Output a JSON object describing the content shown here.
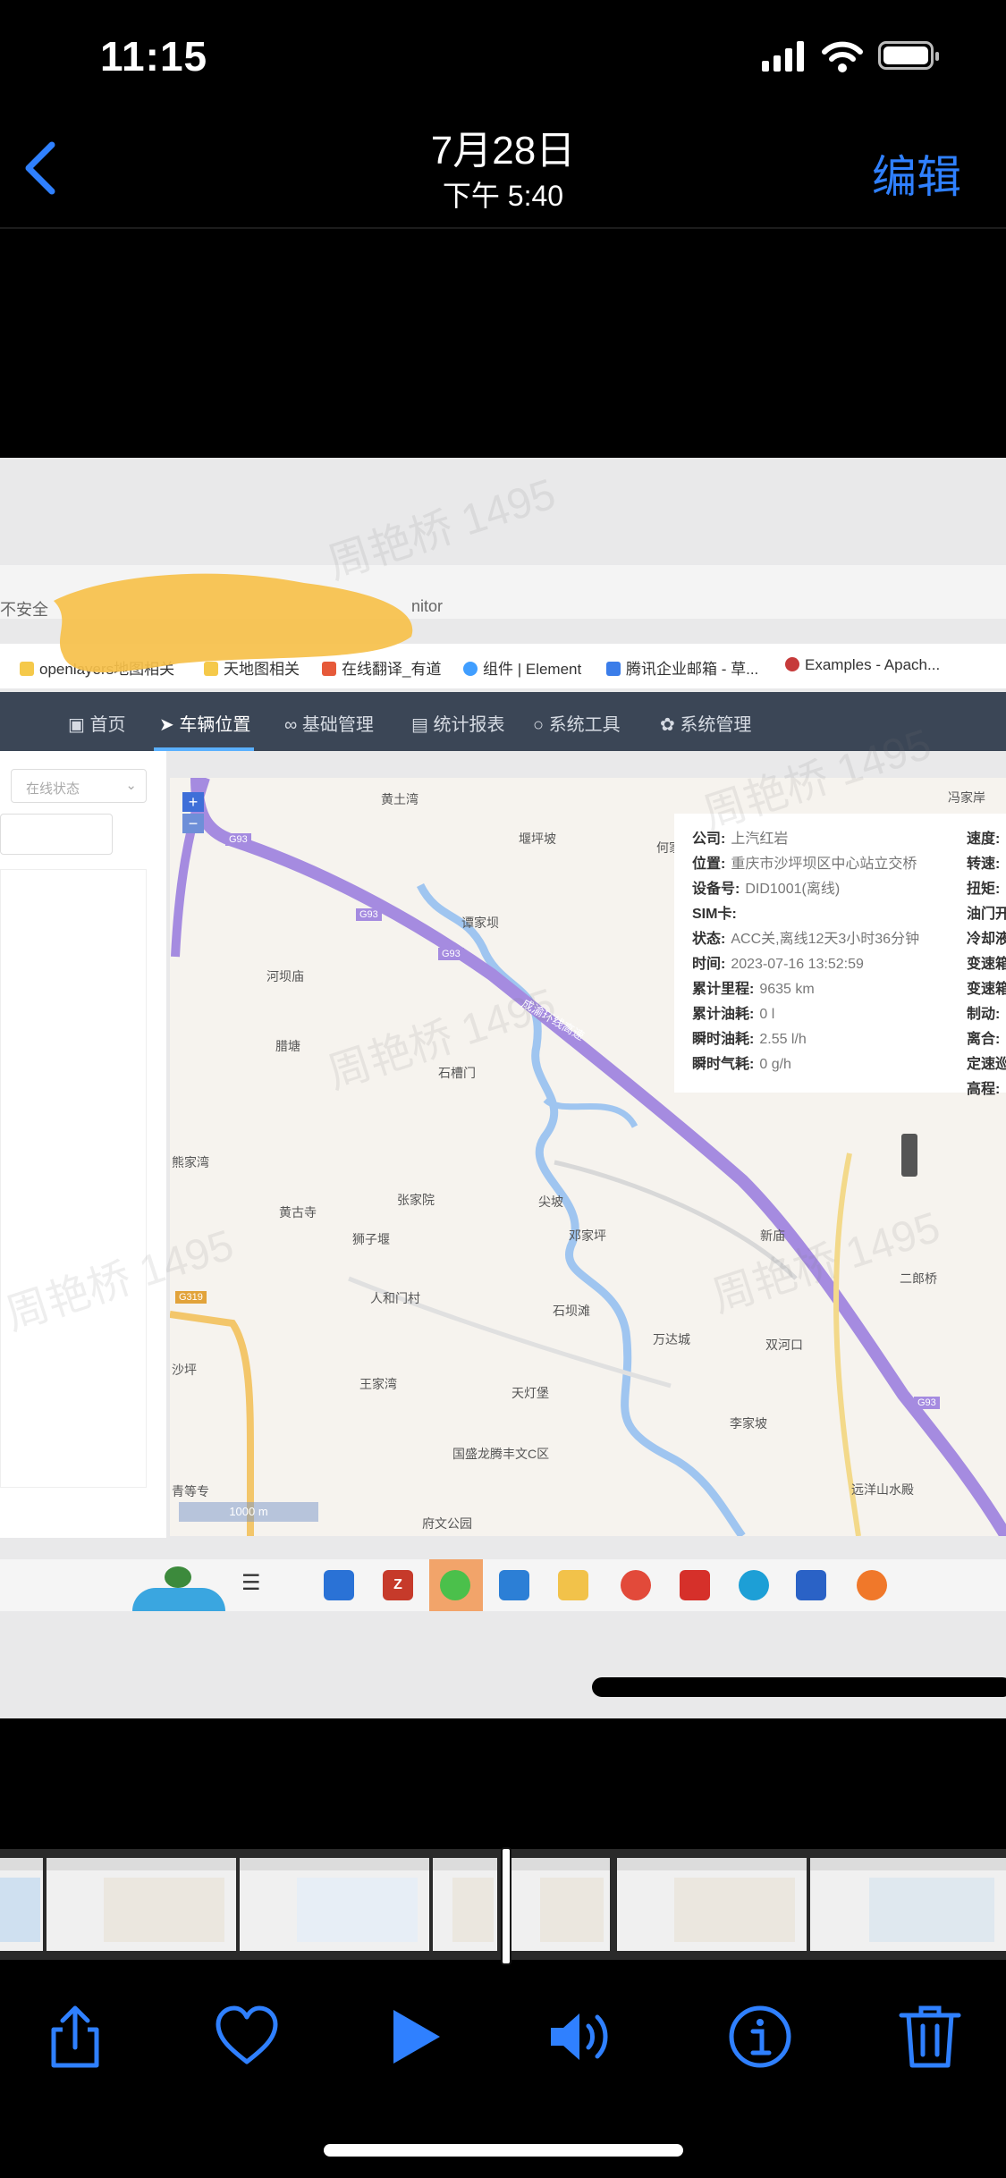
{
  "status_bar": {
    "time": "11:15"
  },
  "nav": {
    "back_icon": "chevron-left-icon",
    "title": "7月28日",
    "subtitle": "下午 5:40",
    "edit_label": "编辑"
  },
  "video": {
    "watermark": "周艳桥 1495",
    "browser": {
      "address_fragment": "不安全",
      "address_tail": "nitor",
      "bookmarks": [
        "openlayers地图相关",
        "天地图相关",
        "在线翻译_有道",
        "组件 | Element",
        "腾讯企业邮箱 - 草...",
        "Examples - Apach..."
      ]
    },
    "app_nav": [
      "首页",
      "车辆位置",
      "基础管理",
      "统计报表",
      "系统工具",
      "系统管理"
    ],
    "left_panel": {
      "filter_placeholder": "在线状态"
    },
    "map": {
      "zoom_in": "+",
      "zoom_out": "−",
      "scale": "1000 m",
      "places": [
        "黄土湾",
        "堰坪坡",
        "何家",
        "冯家岸",
        "谭家坝",
        "河坝庙",
        "腊塘",
        "石槽门",
        "熊家湾",
        "黄古寺",
        "张家院",
        "尖坡",
        "邓家坪",
        "新庙",
        "狮子堰",
        "人和门村",
        "石坝滩",
        "二郎桥",
        "万达城",
        "双河口",
        "王家湾",
        "天灯堡",
        "李家坡",
        "远洋山水殿",
        "国盛龙腾丰文C区",
        "府文公园",
        "青等专",
        "沙坪"
      ],
      "road_labels": [
        "G93",
        "G93",
        "G93",
        "G93",
        "G319",
        "成渝环线高速"
      ]
    },
    "info": {
      "company_label": "公司:",
      "company": "上汽红岩",
      "location_label": "位置:",
      "location": "重庆市沙坪坝区中心站立交桥",
      "device_label": "设备号:",
      "device": "DID1001(离线)",
      "sim_label": "SIM卡:",
      "sim": "",
      "state_label": "状态:",
      "state": "ACC关,离线12天3小时36分钟",
      "time_label": "时间:",
      "time": "2023-07-16 13:52:59",
      "mileage_label": "累计里程:",
      "mileage": "9635 km",
      "fuel_label": "累计油耗:",
      "fuel": "0 l",
      "inst_fuel_label": "瞬时油耗:",
      "inst_fuel": "2.55 l/h",
      "inst_gas_label": "瞬时气耗:",
      "inst_gas": "0 g/h",
      "right_labels": [
        "速度:",
        "转速:",
        "扭矩:",
        "油门开",
        "冷却液",
        "变速箱",
        "变速箱",
        "制动:",
        "离合:",
        "定速巡",
        "高程:"
      ]
    }
  },
  "toolbar": {
    "share": "share-icon",
    "favorite": "heart-icon",
    "play": "play-icon",
    "volume": "speaker-icon",
    "info": "info-icon",
    "delete": "trash-icon"
  },
  "colors": {
    "accent": "#2f80ff",
    "route": "#a58be0",
    "nav_bg": "#3b4656"
  }
}
